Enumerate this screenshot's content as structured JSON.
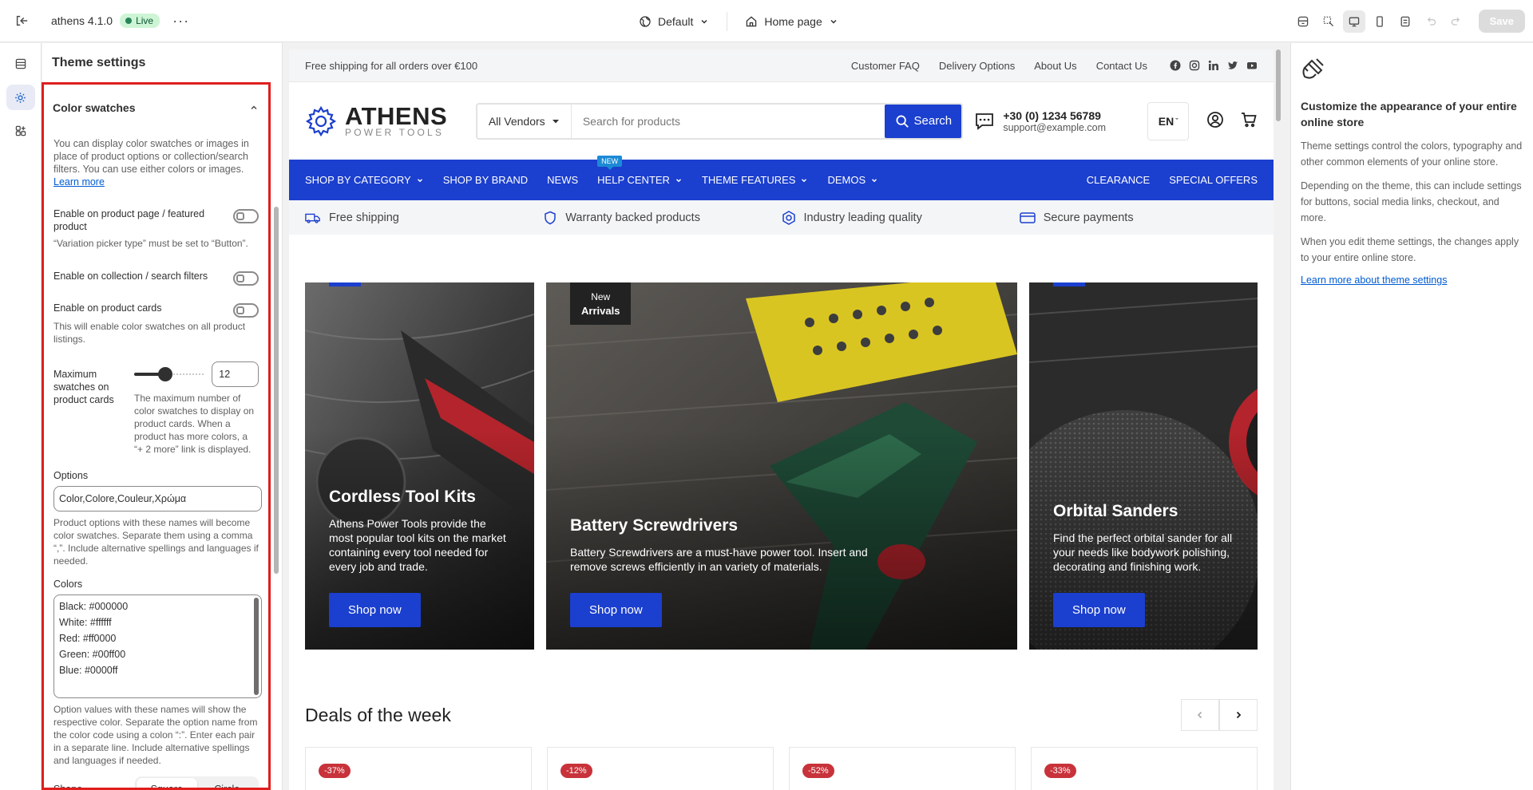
{
  "topbar": {
    "app_name": "athens 4.1.0",
    "status": "Live",
    "more": "···",
    "theme_variant": "Default",
    "page": "Home page",
    "save_label": "Save"
  },
  "panel": {
    "title": "Theme settings",
    "section_title": "Color swatches",
    "intro": "You can display color swatches or images in place of product options or collection/search filters. You can use either colors or images.",
    "intro_link": "Learn more",
    "toggle_product_page": "Enable on product page / featured product",
    "toggle_product_page_help": "“Variation picker type” must be set to “Button”.",
    "toggle_collection": "Enable on collection / search filters",
    "toggle_cards": "Enable on product cards",
    "toggle_cards_help": "This will enable color swatches on all product listings.",
    "max_label": "Maximum swatches on product cards",
    "max_value": "12",
    "max_fraction": 0.45,
    "max_help": "The maximum number of color swatches to display on product cards. When a product has more colors, a “+ 2 more” link is displayed.",
    "options_label": "Options",
    "options_value": "Color,Colore,Couleur,Χρώμα",
    "options_help": "Product options with these names will become color swatches. Separate them using a comma “,”. Include alternative spellings and languages if needed.",
    "colors_label": "Colors",
    "colors_lines": [
      "Black: #000000",
      "White: #ffffff",
      "Red: #ff0000",
      "Green: #00ff00",
      "Blue: #0000ff"
    ],
    "colors_help": "Option values with these names will show the respective color. Separate the option name from the color code using a colon “:”. Enter each pair in a separate line. Include alternative spellings and languages if needed.",
    "shape_label": "Shape",
    "shape_square": "Square",
    "shape_circle": "Circle"
  },
  "store": {
    "announcement": "Free shipping for all orders over €100",
    "links": [
      "Customer FAQ",
      "Delivery Options",
      "About Us",
      "Contact Us"
    ],
    "logo_main": "ATHENS",
    "logo_sub": "POWER TOOLS",
    "vendor_select": "All Vendors",
    "search_placeholder": "Search for products",
    "search_button": "Search",
    "phone": "+30 (0) 1234 56789",
    "email": "support@example.com",
    "language": "EN",
    "nav": [
      "SHOP BY CATEGORY",
      "SHOP BY BRAND",
      "NEWS",
      "HELP CENTER",
      "THEME FEATURES",
      "DEMOS"
    ],
    "nav_badge": "NEW",
    "nav_right": [
      "CLEARANCE",
      "SPECIAL OFFERS"
    ],
    "usps": [
      "Free shipping",
      "Warranty backed products",
      "Industry leading quality",
      "Secure payments"
    ],
    "cards": [
      {
        "title": "Cordless Tool Kits",
        "text": "Athens Power Tools provide the most popular tool kits on the market containing every tool needed for every job and trade.",
        "button": "Shop now"
      },
      {
        "title": "Battery Screwdrivers",
        "text": "Battery Screwdrivers are a must-have power tool. Insert and remove screws efficiently in an variety of materials.",
        "button": "Shop now",
        "tag_top": "New",
        "tag_bottom": "Arrivals"
      },
      {
        "title": "Orbital Sanders",
        "text": "Find the perfect orbital sander for all your needs like bodywork polishing, decorating and finishing work.",
        "button": "Shop now"
      }
    ],
    "deals_title": "Deals of the week",
    "discounts": [
      "-37%",
      "-12%",
      "-52%",
      "-33%"
    ]
  },
  "info": {
    "heading": "Customize the appearance of your entire online store",
    "p1": "Theme settings control the colors, typography and other common elements of your online store.",
    "p2": "Depending on the theme, this can include settings for buttons, social media links, checkout, and more.",
    "p3": "When you edit theme settings, the changes apply to your entire online store.",
    "link": "Learn more about theme settings"
  },
  "colors": {
    "brand_blue": "#1b3fce",
    "highlight_red": "#e01e1e",
    "discount_red": "#c8323a"
  }
}
